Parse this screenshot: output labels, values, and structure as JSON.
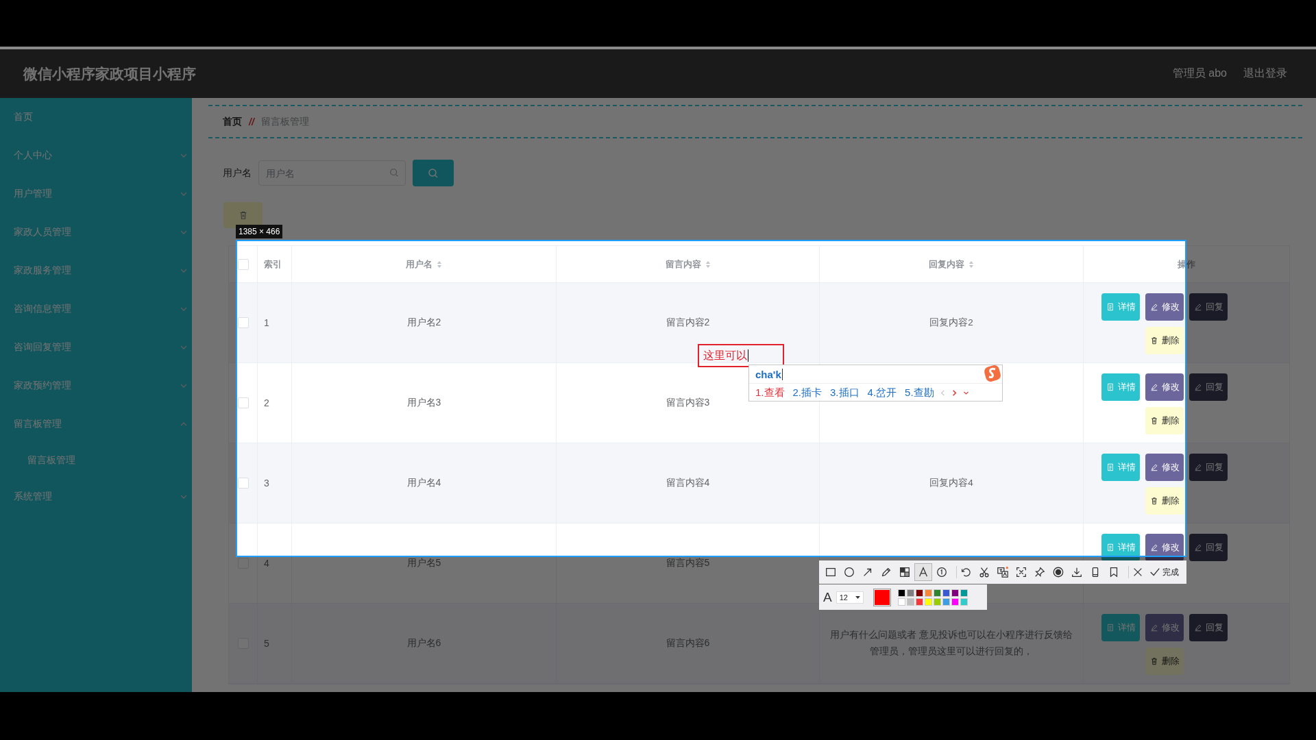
{
  "header": {
    "title": "微信小程序家政项目小程序",
    "user": "管理员 abo",
    "logout": "退出登录"
  },
  "sidebar": {
    "items": [
      {
        "label": "首页"
      },
      {
        "label": "个人中心",
        "expanded": false
      },
      {
        "label": "用户管理",
        "expanded": false
      },
      {
        "label": "家政人员管理",
        "expanded": false
      },
      {
        "label": "家政服务管理",
        "expanded": false
      },
      {
        "label": "咨询信息管理",
        "expanded": false
      },
      {
        "label": "咨询回复管理",
        "expanded": false
      },
      {
        "label": "家政预约管理",
        "expanded": false
      },
      {
        "label": "留言板管理",
        "expanded": true,
        "children": [
          {
            "label": "留言板管理"
          }
        ]
      },
      {
        "label": "系统管理",
        "expanded": false
      }
    ]
  },
  "breadcrumb": {
    "home": "首页",
    "separator": "//",
    "current": "留言板管理"
  },
  "search": {
    "label": "用户名",
    "placeholder": "用户名"
  },
  "table": {
    "all_checked": false,
    "columns": [
      {
        "label": "索引",
        "sortable": false
      },
      {
        "label": "用户名",
        "sortable": true
      },
      {
        "label": "留言内容",
        "sortable": true
      },
      {
        "label": "回复内容",
        "sortable": true
      },
      {
        "label": "操作",
        "sortable": false
      }
    ],
    "rows": [
      {
        "checked": false,
        "index": "1",
        "username": "用户名2",
        "message": "留言内容2",
        "reply": "回复内容2",
        "buttons": [
          {
            "kind": "detail",
            "label": "详情"
          },
          {
            "kind": "edit",
            "label": "修改"
          },
          {
            "kind": "reply",
            "label": "回复"
          },
          {
            "kind": "delete",
            "label": "删除"
          }
        ]
      },
      {
        "checked": false,
        "index": "2",
        "username": "用户名3",
        "message": "留言内容3",
        "buttons": [
          {
            "kind": "detail",
            "label": "详情"
          },
          {
            "kind": "edit",
            "label": "修改"
          },
          {
            "kind": "reply",
            "label": "回复"
          },
          {
            "kind": "delete",
            "label": "删除"
          }
        ]
      },
      {
        "checked": false,
        "index": "3",
        "username": "用户名4",
        "message": "留言内容4",
        "reply": "回复内容4",
        "buttons": [
          {
            "kind": "detail",
            "label": "详情"
          },
          {
            "kind": "edit",
            "label": "修改"
          },
          {
            "kind": "reply",
            "label": "回复"
          },
          {
            "kind": "delete",
            "label": "删除"
          }
        ]
      },
      {
        "checked": false,
        "index": "4",
        "username": "用户名5",
        "message": "留言内容5",
        "buttons": [
          {
            "kind": "detail",
            "label": "详情"
          },
          {
            "kind": "edit",
            "label": "修改"
          },
          {
            "kind": "reply",
            "label": "回复"
          }
        ]
      },
      {
        "checked": false,
        "index": "5",
        "username": "用户名6",
        "message": "留言内容6",
        "reply": "用户有什么问题或者 意见投诉也可以在小程序进行反馈给管理员，管理员这里可以进行回复的，",
        "buttons": [
          {
            "kind": "detail",
            "label": "详情"
          },
          {
            "kind": "edit",
            "label": "修改"
          },
          {
            "kind": "reply",
            "label": "回复"
          },
          {
            "kind": "delete",
            "label": "删除"
          }
        ]
      }
    ]
  },
  "capture": {
    "size": "1385 × 466",
    "annotation": "这里可以",
    "tools": [
      {
        "kind": "rectangle",
        "selected": false
      },
      {
        "kind": "circle",
        "selected": false
      },
      {
        "kind": "arrow",
        "selected": false
      },
      {
        "kind": "pencil",
        "selected": false
      },
      {
        "kind": "mosaic",
        "selected": false
      },
      {
        "kind": "text",
        "selected": true
      },
      {
        "kind": "number",
        "selected": false
      },
      {
        "kind": "undo",
        "selected": false
      },
      {
        "kind": "scissors",
        "selected": false
      },
      {
        "kind": "translate",
        "selected": false
      },
      {
        "kind": "ocr",
        "selected": false
      },
      {
        "kind": "pin",
        "selected": false
      },
      {
        "kind": "record",
        "selected": false
      },
      {
        "kind": "download",
        "selected": false
      },
      {
        "kind": "phone",
        "selected": false
      },
      {
        "kind": "bookmark",
        "selected": false
      },
      {
        "kind": "close",
        "selected": false
      }
    ],
    "done": "完成",
    "font_label": "A",
    "font_size": "12",
    "palette": [
      {
        "color": "#000000"
      },
      {
        "color": "#808080"
      },
      {
        "color": "#800000"
      },
      {
        "color": "#f7883a"
      },
      {
        "color": "#308430"
      },
      {
        "color": "#385ad3"
      },
      {
        "color": "#800080"
      },
      {
        "color": "#009999"
      },
      {
        "color": "#ffffff"
      },
      {
        "color": "#c0c0c0"
      },
      {
        "color": "#fb3838"
      },
      {
        "color": "#ffff00"
      },
      {
        "color": "#99cc00"
      },
      {
        "color": "#3d9ee3"
      },
      {
        "color": "#ff00ff"
      },
      {
        "color": "#33cccc"
      }
    ]
  },
  "ime": {
    "input": "cha'k",
    "candidates": [
      {
        "label": "1.查看",
        "selected": true
      },
      {
        "label": "2.插卡",
        "selected": false
      },
      {
        "label": "3.插口",
        "selected": false
      },
      {
        "label": "4.岔开",
        "selected": false
      },
      {
        "label": "5.查勘",
        "selected": false
      }
    ]
  }
}
